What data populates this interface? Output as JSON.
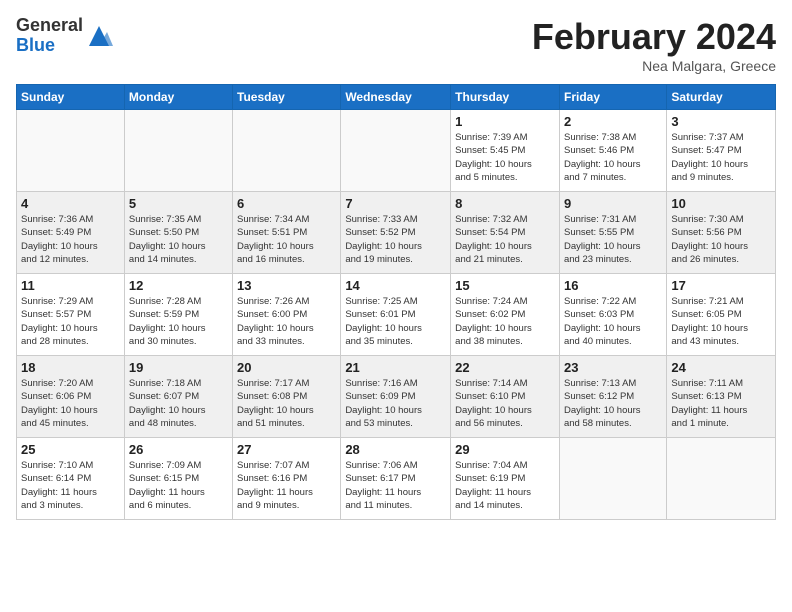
{
  "logo": {
    "general": "General",
    "blue": "Blue"
  },
  "header": {
    "month": "February 2024",
    "location": "Nea Malgara, Greece"
  },
  "weekdays": [
    "Sunday",
    "Monday",
    "Tuesday",
    "Wednesday",
    "Thursday",
    "Friday",
    "Saturday"
  ],
  "weeks": [
    [
      {
        "day": "",
        "info": ""
      },
      {
        "day": "",
        "info": ""
      },
      {
        "day": "",
        "info": ""
      },
      {
        "day": "",
        "info": ""
      },
      {
        "day": "1",
        "info": "Sunrise: 7:39 AM\nSunset: 5:45 PM\nDaylight: 10 hours\nand 5 minutes."
      },
      {
        "day": "2",
        "info": "Sunrise: 7:38 AM\nSunset: 5:46 PM\nDaylight: 10 hours\nand 7 minutes."
      },
      {
        "day": "3",
        "info": "Sunrise: 7:37 AM\nSunset: 5:47 PM\nDaylight: 10 hours\nand 9 minutes."
      }
    ],
    [
      {
        "day": "4",
        "info": "Sunrise: 7:36 AM\nSunset: 5:49 PM\nDaylight: 10 hours\nand 12 minutes."
      },
      {
        "day": "5",
        "info": "Sunrise: 7:35 AM\nSunset: 5:50 PM\nDaylight: 10 hours\nand 14 minutes."
      },
      {
        "day": "6",
        "info": "Sunrise: 7:34 AM\nSunset: 5:51 PM\nDaylight: 10 hours\nand 16 minutes."
      },
      {
        "day": "7",
        "info": "Sunrise: 7:33 AM\nSunset: 5:52 PM\nDaylight: 10 hours\nand 19 minutes."
      },
      {
        "day": "8",
        "info": "Sunrise: 7:32 AM\nSunset: 5:54 PM\nDaylight: 10 hours\nand 21 minutes."
      },
      {
        "day": "9",
        "info": "Sunrise: 7:31 AM\nSunset: 5:55 PM\nDaylight: 10 hours\nand 23 minutes."
      },
      {
        "day": "10",
        "info": "Sunrise: 7:30 AM\nSunset: 5:56 PM\nDaylight: 10 hours\nand 26 minutes."
      }
    ],
    [
      {
        "day": "11",
        "info": "Sunrise: 7:29 AM\nSunset: 5:57 PM\nDaylight: 10 hours\nand 28 minutes."
      },
      {
        "day": "12",
        "info": "Sunrise: 7:28 AM\nSunset: 5:59 PM\nDaylight: 10 hours\nand 30 minutes."
      },
      {
        "day": "13",
        "info": "Sunrise: 7:26 AM\nSunset: 6:00 PM\nDaylight: 10 hours\nand 33 minutes."
      },
      {
        "day": "14",
        "info": "Sunrise: 7:25 AM\nSunset: 6:01 PM\nDaylight: 10 hours\nand 35 minutes."
      },
      {
        "day": "15",
        "info": "Sunrise: 7:24 AM\nSunset: 6:02 PM\nDaylight: 10 hours\nand 38 minutes."
      },
      {
        "day": "16",
        "info": "Sunrise: 7:22 AM\nSunset: 6:03 PM\nDaylight: 10 hours\nand 40 minutes."
      },
      {
        "day": "17",
        "info": "Sunrise: 7:21 AM\nSunset: 6:05 PM\nDaylight: 10 hours\nand 43 minutes."
      }
    ],
    [
      {
        "day": "18",
        "info": "Sunrise: 7:20 AM\nSunset: 6:06 PM\nDaylight: 10 hours\nand 45 minutes."
      },
      {
        "day": "19",
        "info": "Sunrise: 7:18 AM\nSunset: 6:07 PM\nDaylight: 10 hours\nand 48 minutes."
      },
      {
        "day": "20",
        "info": "Sunrise: 7:17 AM\nSunset: 6:08 PM\nDaylight: 10 hours\nand 51 minutes."
      },
      {
        "day": "21",
        "info": "Sunrise: 7:16 AM\nSunset: 6:09 PM\nDaylight: 10 hours\nand 53 minutes."
      },
      {
        "day": "22",
        "info": "Sunrise: 7:14 AM\nSunset: 6:10 PM\nDaylight: 10 hours\nand 56 minutes."
      },
      {
        "day": "23",
        "info": "Sunrise: 7:13 AM\nSunset: 6:12 PM\nDaylight: 10 hours\nand 58 minutes."
      },
      {
        "day": "24",
        "info": "Sunrise: 7:11 AM\nSunset: 6:13 PM\nDaylight: 11 hours\nand 1 minute."
      }
    ],
    [
      {
        "day": "25",
        "info": "Sunrise: 7:10 AM\nSunset: 6:14 PM\nDaylight: 11 hours\nand 3 minutes."
      },
      {
        "day": "26",
        "info": "Sunrise: 7:09 AM\nSunset: 6:15 PM\nDaylight: 11 hours\nand 6 minutes."
      },
      {
        "day": "27",
        "info": "Sunrise: 7:07 AM\nSunset: 6:16 PM\nDaylight: 11 hours\nand 9 minutes."
      },
      {
        "day": "28",
        "info": "Sunrise: 7:06 AM\nSunset: 6:17 PM\nDaylight: 11 hours\nand 11 minutes."
      },
      {
        "day": "29",
        "info": "Sunrise: 7:04 AM\nSunset: 6:19 PM\nDaylight: 11 hours\nand 14 minutes."
      },
      {
        "day": "",
        "info": ""
      },
      {
        "day": "",
        "info": ""
      }
    ]
  ]
}
